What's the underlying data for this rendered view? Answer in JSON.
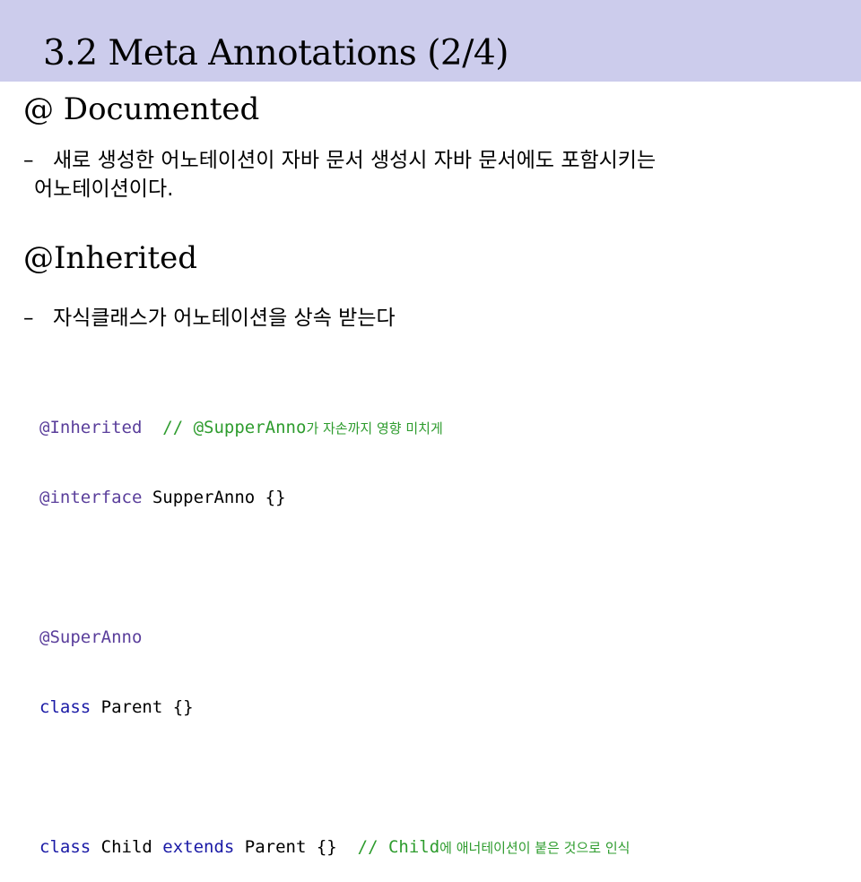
{
  "slide": {
    "title": "3.2 Meta Annotations (2/4)"
  },
  "sections": [
    {
      "heading": "@ Documented",
      "bullet_marker": "–",
      "bullet_line1": "새로 생성한 어노테이션이 자바 문서 생성시 자바 문서에도 포함시키는",
      "bullet_line2": "어노테이션이다."
    },
    {
      "heading": "@Inherited",
      "bullet_marker": "–",
      "bullet_line1": "자식클래스가 어노테이션을 상속 받는다"
    }
  ],
  "code": {
    "line1_annotation": "@Inherited",
    "line1_comment": "// @SupperAnno",
    "line1_comment_kr": "가 자손까지 영향 미치게",
    "line2_keyword": "@interface",
    "line2_rest": " SupperAnno {}",
    "line4_annotation": "@SuperAnno",
    "line5_keyword": "class",
    "line5_rest": " Parent {}",
    "line7_keyword1": "class",
    "line7_name": " Child ",
    "line7_keyword2": "extends",
    "line7_rest": " Parent {}",
    "line7_comment": "// Child",
    "line7_comment_kr": "에 애너테이션이 붙은 것으로 인식"
  },
  "colors": {
    "title_band": "#ccccec",
    "keyword": "#1a1aa6",
    "annotation": "#5a3e9b",
    "comment": "#2e9c2e"
  }
}
